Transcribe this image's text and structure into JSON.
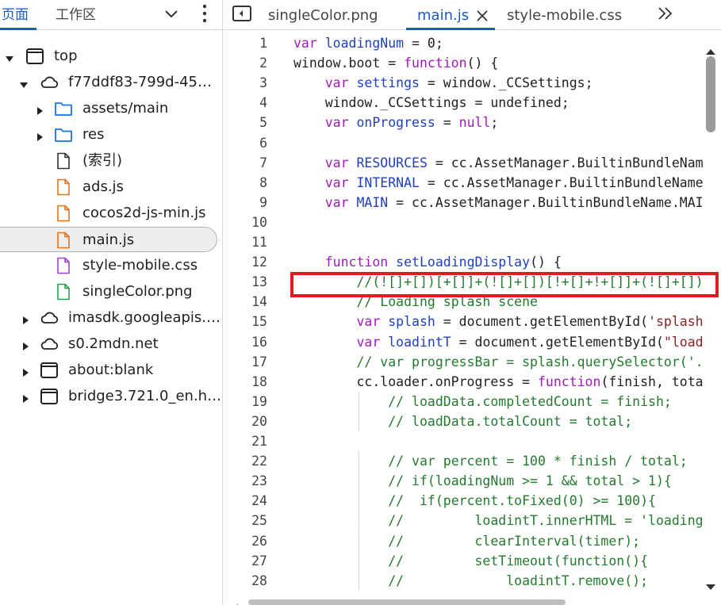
{
  "navigator": {
    "tabs": [
      {
        "label": "页面"
      },
      {
        "label": "工作区"
      }
    ],
    "tree": [
      {
        "label": "top",
        "icon": "frame-icon",
        "expanded": true
      },
      {
        "label": "f77ddf83-799d-45…",
        "icon": "cloud-icon",
        "expanded": true
      },
      {
        "label": "assets/main",
        "icon": "folder-icon"
      },
      {
        "label": "res",
        "icon": "folder-icon"
      },
      {
        "label": "(索引)",
        "icon": "document-icon"
      },
      {
        "label": "ads.js",
        "icon": "script-file-icon"
      },
      {
        "label": "cocos2d-js-min.js",
        "icon": "script-file-icon"
      },
      {
        "label": "main.js",
        "icon": "script-file-icon",
        "selected": true
      },
      {
        "label": "style-mobile.css",
        "icon": "stylesheet-file-icon"
      },
      {
        "label": "singleColor.png",
        "icon": "image-file-icon"
      },
      {
        "label": "imasdk.googleapis.…",
        "icon": "cloud-icon"
      },
      {
        "label": "s0.2mdn.net",
        "icon": "cloud-icon"
      },
      {
        "label": "about:blank",
        "icon": "frame-icon"
      },
      {
        "label": "bridge3.721.0_en.h…",
        "icon": "frame-icon"
      }
    ]
  },
  "editor": {
    "tabs": [
      {
        "label": "singleColor.png"
      },
      {
        "label": "main.js",
        "active": true
      },
      {
        "label": "style-mobile.css"
      }
    ],
    "lines": [
      {
        "n": "1",
        "text": "var loadingNum = 0;"
      },
      {
        "n": "2",
        "text": "window.boot = function() {"
      },
      {
        "n": "3",
        "text": "    var settings = window._CCSettings;"
      },
      {
        "n": "4",
        "text": "    window._CCSettings = undefined;"
      },
      {
        "n": "5",
        "text": "    var onProgress = null;"
      },
      {
        "n": "6",
        "text": ""
      },
      {
        "n": "7",
        "text": "    var RESOURCES = cc.AssetManager.BuiltinBundleNam"
      },
      {
        "n": "8",
        "text": "    var INTERNAL = cc.AssetManager.BuiltinBundleName"
      },
      {
        "n": "9",
        "text": "    var MAIN = cc.AssetManager.BuiltinBundleName.MAI"
      },
      {
        "n": "10",
        "text": ""
      },
      {
        "n": "11",
        "text": ""
      },
      {
        "n": "12",
        "text": "    function setLoadingDisplay() {"
      },
      {
        "n": "13",
        "text": "        //(![]+[])[+[]]+(![]+[])[!+[]+!+[]]+(![]+[])"
      },
      {
        "n": "14",
        "text": "        // Loading splash scene"
      },
      {
        "n": "15",
        "text": "        var splash = document.getElementById('splash"
      },
      {
        "n": "16",
        "text": "        var loadintT = document.getElementById(\"load"
      },
      {
        "n": "17",
        "text": "        // var progressBar = splash.querySelector('."
      },
      {
        "n": "18",
        "text": "        cc.loader.onProgress = function(finish, tota"
      },
      {
        "n": "19",
        "text": "            // loadData.completedCount = finish;"
      },
      {
        "n": "20",
        "text": "            // loadData.totalCount = total;"
      },
      {
        "n": "21",
        "text": ""
      },
      {
        "n": "22",
        "text": "            // var percent = 100 * finish / total;"
      },
      {
        "n": "23",
        "text": "            // if(loadingNum >= 1 && total > 1){"
      },
      {
        "n": "24",
        "text": "            //  if(percent.toFixed(0) >= 100){"
      },
      {
        "n": "25",
        "text": "            //         loadintT.innerHTML = 'loading"
      },
      {
        "n": "26",
        "text": "            //         clearInterval(timer);"
      },
      {
        "n": "27",
        "text": "            //         setTimeout(function(){"
      },
      {
        "n": "28",
        "text": "            //             loadintT.remove();"
      }
    ]
  },
  "colors": {
    "accent": "#1a57c8",
    "keyword": "#a01bb8",
    "identifier": "#1f3fbf",
    "string": "#8a1f1f",
    "comment": "#237a2f",
    "highlight": "#e11b22"
  }
}
